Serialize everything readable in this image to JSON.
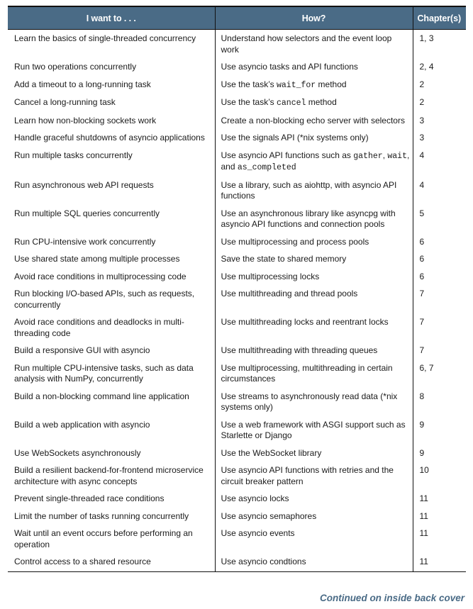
{
  "header": {
    "col1": "I want to . . .",
    "col2": "How?",
    "col3": "Chapter(s)"
  },
  "rows": [
    {
      "want": "Learn the basics of single-threaded concurrency",
      "how": [
        "Understand how selectors and the event loop work"
      ],
      "chapters": "1, 3"
    },
    {
      "want": "Run two operations concurrently",
      "how": [
        "Use asyncio tasks and API functions"
      ],
      "chapters": "2, 4"
    },
    {
      "want": "Add a timeout to a long-running task",
      "how": [
        "Use the task’s ",
        {
          "code": "wait_for"
        },
        " method"
      ],
      "chapters": "2"
    },
    {
      "want": "Cancel a long-running task",
      "how": [
        "Use the task’s ",
        {
          "code": "cancel"
        },
        " method"
      ],
      "chapters": "2"
    },
    {
      "want": "Learn how non-blocking sockets work",
      "how": [
        "Create a non-blocking echo server with selectors"
      ],
      "chapters": "3"
    },
    {
      "want": "Handle graceful shutdowns of asyncio applications",
      "how": [
        "Use the signals API (*nix systems only)"
      ],
      "chapters": "3"
    },
    {
      "want": "Run multiple tasks concurrently",
      "how": [
        "Use asyncio API functions such as ",
        {
          "code": "gather"
        },
        ", ",
        {
          "code": "wait"
        },
        ", and ",
        {
          "code": "as_completed"
        }
      ],
      "chapters": "4"
    },
    {
      "want": "Run asynchronous web API requests",
      "how": [
        "Use a library, such as aiohttp, with asyncio API functions"
      ],
      "chapters": "4"
    },
    {
      "want": "Run multiple SQL queries concurrently",
      "how": [
        "Use an asynchronous library like asyncpg with asyncio API functions and connection pools"
      ],
      "chapters": "5"
    },
    {
      "want": "Run CPU-intensive work concurrently",
      "how": [
        "Use multiprocessing and process pools"
      ],
      "chapters": "6"
    },
    {
      "want": "Use shared state among multiple processes",
      "how": [
        "Save the state to shared memory"
      ],
      "chapters": "6"
    },
    {
      "want": "Avoid race conditions in multiprocessing code",
      "how": [
        "Use multiprocessing locks"
      ],
      "chapters": "6"
    },
    {
      "want": "Run blocking I/O-based APIs, such as requests, concurrently",
      "how": [
        "Use multithreading and thread pools"
      ],
      "chapters": "7"
    },
    {
      "want": "Avoid race conditions and deadlocks in multi-threading code",
      "how": [
        "Use multithreading locks and reentrant locks"
      ],
      "chapters": "7"
    },
    {
      "want": "Build a responsive GUI with asyncio",
      "how": [
        "Use multithreading with threading queues"
      ],
      "chapters": "7"
    },
    {
      "want": "Run multiple CPU-intensive tasks, such as data analysis with NumPy, concurrently",
      "how": [
        "Use multiprocessing, multithreading in certain circumstances"
      ],
      "chapters": "6, 7"
    },
    {
      "want": "Build a non-blocking command line application",
      "how": [
        "Use streams to asynchronously read data (*nix systems only)"
      ],
      "chapters": "8"
    },
    {
      "want": "Build a web application with asyncio",
      "how": [
        "Use a web framework with ASGI support such as Starlette or Django"
      ],
      "chapters": "9"
    },
    {
      "want": "Use WebSockets asynchronously",
      "how": [
        "Use the WebSocket library"
      ],
      "chapters": "9"
    },
    {
      "want": "Build a resilient backend-for-frontend microservice architecture with async concepts",
      "how": [
        "Use asyncio API functions with retries and the circuit breaker pattern"
      ],
      "chapters": "10"
    },
    {
      "want": "Prevent single-threaded race conditions",
      "how": [
        "Use asyncio locks"
      ],
      "chapters": "11"
    },
    {
      "want": "Limit the number of tasks running concurrently",
      "how": [
        "Use asyncio semaphores"
      ],
      "chapters": "11"
    },
    {
      "want": "Wait until an event occurs before performing an operation",
      "how": [
        "Use asyncio events"
      ],
      "chapters": "11"
    },
    {
      "want": "Control access to a shared resource",
      "how": [
        "Use asyncio condtions"
      ],
      "chapters": "11"
    }
  ],
  "footer": {
    "continued": "Continued on inside back cover"
  },
  "colors": {
    "header_bg": "#4a6b86",
    "accent_text": "#4a6b86"
  }
}
